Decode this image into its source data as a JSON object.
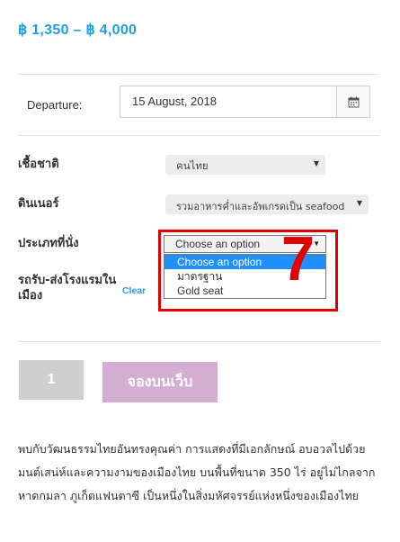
{
  "price_range": "฿ 1,350 – ฿ 4,000",
  "departure": {
    "label": "Departure:",
    "value": "15 August, 2018",
    "icon": "calendar-icon"
  },
  "fields": {
    "nationality": {
      "label": "เชื้อชาติ",
      "value": "คนไทย"
    },
    "dinner": {
      "label": "ดินเนอร์",
      "value": "รวมอาหารค่ำและอัพเกรดเป็น seafood"
    },
    "seat": {
      "label": "ประเภทที่นั่ง",
      "value": "Choose an option",
      "options": [
        "Choose an option",
        "มาตรฐาน",
        "Gold seat"
      ]
    },
    "transfer": {
      "label_line1": "รถรับ-ส่งโรงแรมใน",
      "label_line2": "เมือง"
    }
  },
  "clear_label": "Clear",
  "annotation_number": "7",
  "annotation_color": "#e00000",
  "quantity": "1",
  "book_button": "จองบนเว็บ",
  "description": "พบกับวัฒนธรรมไทยอันทรงคุณค่า การแสดงที่มีเอกลักษณ์ อบอวลไปด้วยมนต์เสน่ห์และความงามของเมืองไทย บนพื้นที่ขนาด 350 ไร่ อยู่ไม่ไกลจากหาดกมลา ภูเก็ตแฟนตาซี เป็นหนึ่งในสิ่งมหัศจรรย์แห่งหนึ่งของเมืองไทย",
  "colors": {
    "accent": "#1ea0e0",
    "book_button": "#d3aed0",
    "highlight": "#e00000",
    "dropdown_active": "#1e90ff"
  }
}
